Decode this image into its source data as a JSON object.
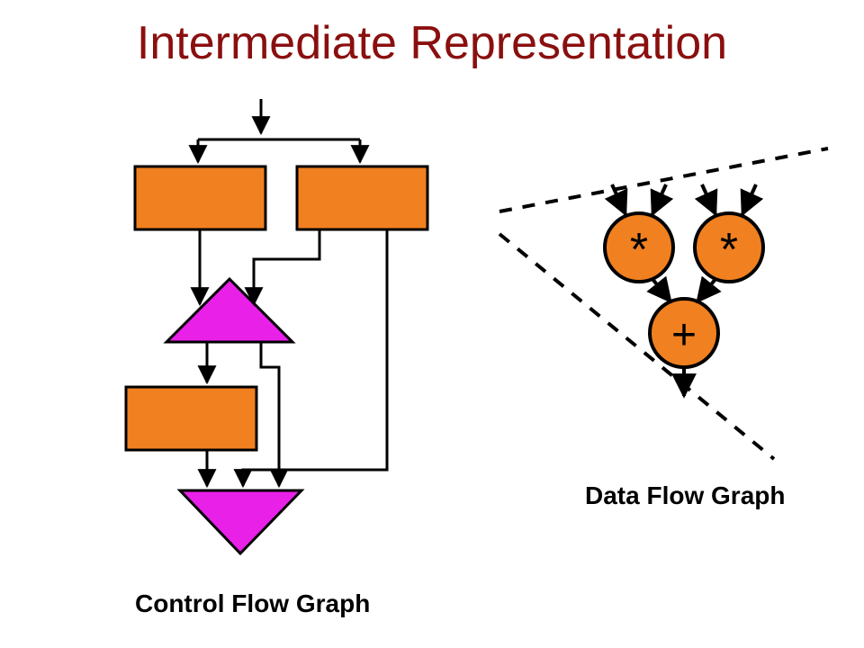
{
  "title": "Intermediate Representation",
  "labels": {
    "control": "Control Flow Graph",
    "data": "Data Flow Graph"
  },
  "nodes": {
    "mul1": "*",
    "mul2": "*",
    "add": "+"
  },
  "colors": {
    "rect": "#f08020",
    "triangle": "#e820e8",
    "circle": "#f08020",
    "title": "#8a0f0f"
  }
}
